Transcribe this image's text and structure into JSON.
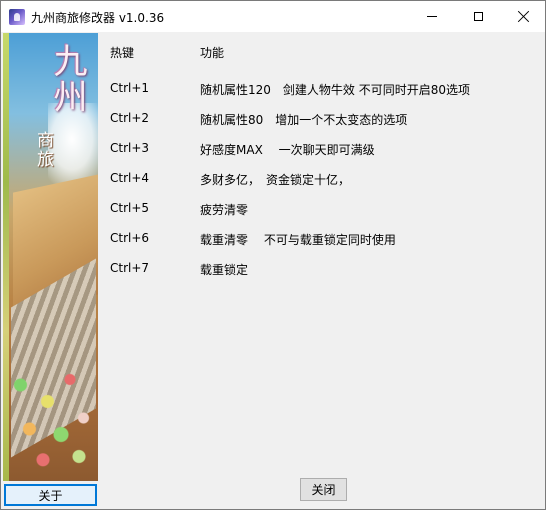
{
  "window": {
    "title": "九州商旅修改器 v1.0.36"
  },
  "banner": {
    "logo_main": "九州",
    "logo_sub": "商旅"
  },
  "table": {
    "headers": [
      "热键",
      "功能"
    ],
    "rows": [
      {
        "key": "Ctrl+1",
        "desc": "随机属性120　剑建人物牛效 不可同时开启80选项"
      },
      {
        "key": "Ctrl+2",
        "desc": "随机属性80　增加一个不太变态的选项"
      },
      {
        "key": "Ctrl+3",
        "desc": "好感度MAX　 一次聊天即可满级"
      },
      {
        "key": "Ctrl+4",
        "desc": "多财多亿，　资金锁定十亿，"
      },
      {
        "key": "Ctrl+5",
        "desc": "疲劳清零"
      },
      {
        "key": "Ctrl+6",
        "desc": "载重清零　 不可与载重锁定同时使用"
      },
      {
        "key": "Ctrl+7",
        "desc": "载重锁定"
      }
    ]
  },
  "buttons": {
    "about": "关于",
    "close": "关闭"
  }
}
